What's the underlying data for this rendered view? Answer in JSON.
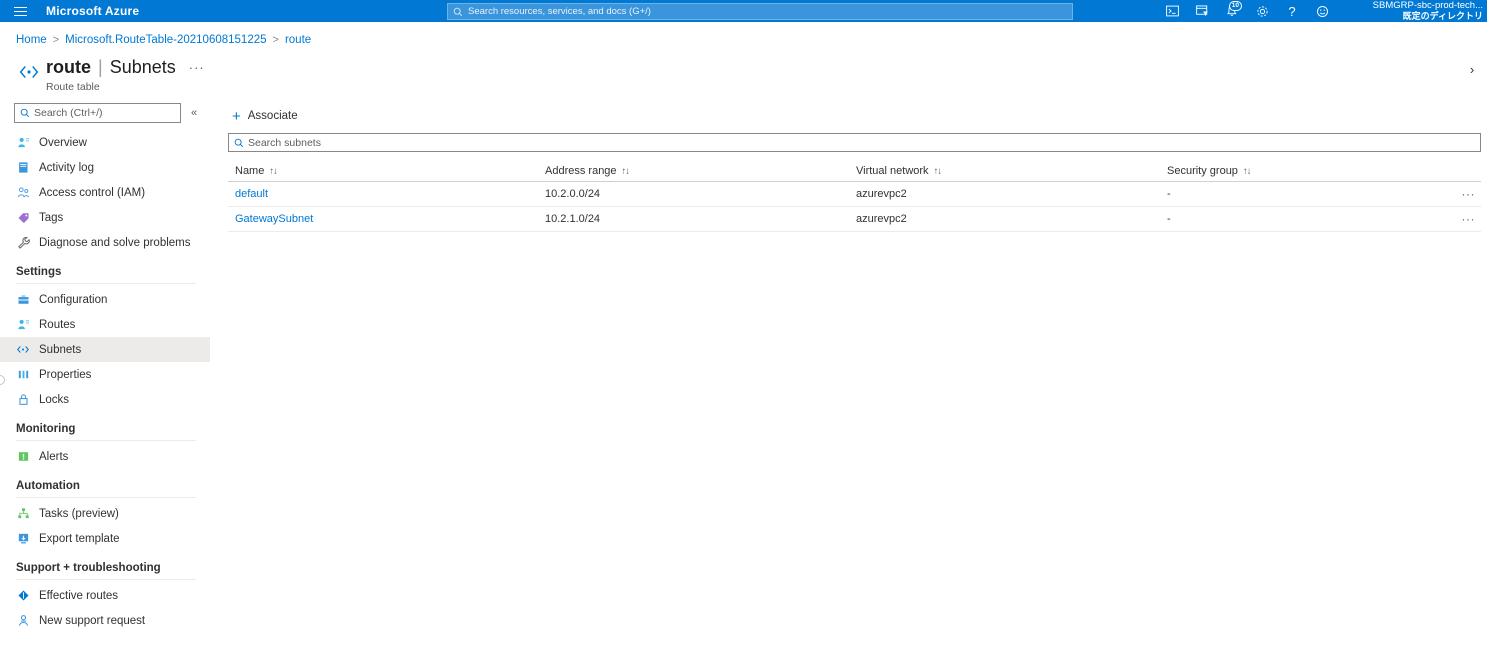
{
  "topbar": {
    "brand": "Microsoft Azure",
    "menu_icon": "hamburger-icon",
    "search_placeholder": "Search resources, services, and docs (G+/)",
    "icons": [
      {
        "name": "cloud-shell-icon",
        "glyph": "⌨"
      },
      {
        "name": "directory-filter-icon",
        "glyph": "⊟"
      },
      {
        "name": "notifications-icon",
        "glyph": "ὑ4",
        "badge": "10"
      },
      {
        "name": "settings-gear-icon",
        "glyph": "⚙"
      },
      {
        "name": "help-icon",
        "glyph": "?"
      },
      {
        "name": "feedback-smiley-icon",
        "glyph": "☺"
      }
    ],
    "account_name": "SBMGRP-sbc-prod-tech...",
    "account_directory": "既定のディレクトリ"
  },
  "breadcrumb": [
    "Home",
    "Microsoft.RouteTable-20210608151225",
    "route"
  ],
  "header": {
    "resource_name": "route",
    "divider": "|",
    "page_section": "Subnets",
    "ellipsis": "···",
    "caption": "Route table",
    "close_glyph": "›"
  },
  "sidebar": {
    "search_placeholder": "Search (Ctrl+/)",
    "collapse_glyph": "«",
    "items": [
      {
        "label": "Overview",
        "name": "sidebar-item-overview",
        "glyph": "☲",
        "color": "#41b5e8"
      },
      {
        "label": "Activity log",
        "name": "sidebar-item-activity-log",
        "glyph": "▤",
        "color": "#3a96dd"
      },
      {
        "label": "Access control (IAM)",
        "name": "sidebar-item-access-control",
        "glyph": "☿",
        "color": "#5ca4e0"
      },
      {
        "label": "Tags",
        "name": "sidebar-item-tags",
        "glyph": "◆",
        "color": "#9b6fd4"
      },
      {
        "label": "Diagnose and solve problems",
        "name": "sidebar-item-diagnose",
        "glyph": "✐",
        "color": "#605e5c"
      }
    ],
    "groups": [
      {
        "label": "Settings",
        "name": "sidebar-group-settings",
        "items": [
          {
            "label": "Configuration",
            "name": "sidebar-item-configuration",
            "glyph": "▥",
            "color": "#3a96dd",
            "selected": false
          },
          {
            "label": "Routes",
            "name": "sidebar-item-routes",
            "glyph": "☲",
            "color": "#41b5e8",
            "selected": false
          },
          {
            "label": "Subnets",
            "name": "sidebar-item-subnets",
            "glyph": "‹·›",
            "color": "#0078d4",
            "selected": true
          },
          {
            "label": "Properties",
            "name": "sidebar-item-properties",
            "glyph": "⦀",
            "color": "#3a96dd",
            "selected": false
          },
          {
            "label": "Locks",
            "name": "sidebar-item-locks",
            "glyph": "⚿",
            "color": "#3a96dd",
            "selected": false
          }
        ]
      },
      {
        "label": "Monitoring",
        "name": "sidebar-group-monitoring",
        "items": [
          {
            "label": "Alerts",
            "name": "sidebar-item-alerts",
            "glyph": "■",
            "color": "#5ec75e",
            "selected": false
          }
        ]
      },
      {
        "label": "Automation",
        "name": "sidebar-group-automation",
        "items": [
          {
            "label": "Tasks (preview)",
            "name": "sidebar-item-tasks",
            "glyph": "⚙",
            "color": "#5ec75e",
            "selected": false
          },
          {
            "label": "Export template",
            "name": "sidebar-item-export-template",
            "glyph": "⬇",
            "color": "#3a96dd",
            "selected": false
          }
        ]
      },
      {
        "label": "Support + troubleshooting",
        "name": "sidebar-group-support",
        "items": [
          {
            "label": "Effective routes",
            "name": "sidebar-item-effective-routes",
            "glyph": "◆",
            "color": "#0078d4",
            "selected": false
          },
          {
            "label": "New support request",
            "name": "sidebar-item-new-support",
            "glyph": "☿",
            "color": "#3a96dd",
            "selected": false
          }
        ]
      }
    ]
  },
  "toolbar": {
    "associate_label": "Associate",
    "associate_plus": "+"
  },
  "filter": {
    "placeholder": "Search subnets"
  },
  "table": {
    "sort_glyph": "↑↓",
    "row_menu_glyph": "···",
    "columns": [
      {
        "label": "Name",
        "name": "column-header-name"
      },
      {
        "label": "Address range",
        "name": "column-header-address-range"
      },
      {
        "label": "Virtual network",
        "name": "column-header-virtual-network"
      },
      {
        "label": "Security group",
        "name": "column-header-security-group"
      }
    ],
    "rows": [
      {
        "name": "default",
        "address_range": "10.2.0.0/24",
        "virtual_network": "azurevpc2",
        "security_group": "-"
      },
      {
        "name": "GatewaySubnet",
        "address_range": "10.2.1.0/24",
        "virtual_network": "azurevpc2",
        "security_group": "-"
      }
    ]
  },
  "colors": {
    "azure_blue": "#0078d4",
    "topbar_blue": "#0078d4",
    "link_blue": "#0078d4",
    "selected_row": "#edebe9"
  }
}
